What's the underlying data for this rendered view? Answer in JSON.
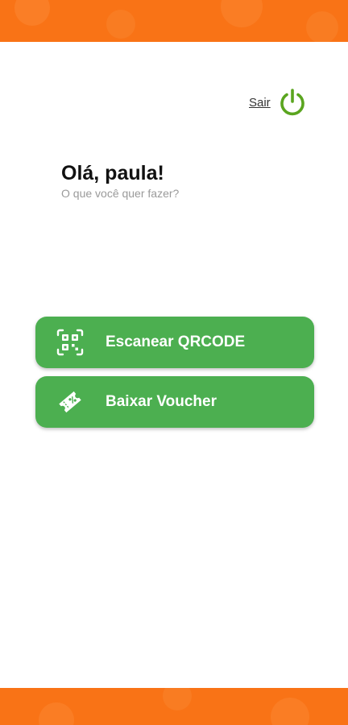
{
  "header": {
    "logout_label": "Sair",
    "logout_icon": "power-icon"
  },
  "greeting": {
    "title": "Olá, paula!",
    "subtitle": "O que você quer fazer?"
  },
  "actions": [
    {
      "label": "Escanear QRCODE",
      "icon": "qrcode-icon"
    },
    {
      "label": "Baixar Voucher",
      "icon": "ticket-icon"
    }
  ],
  "colors": {
    "brand_orange": "#f97316",
    "button_green": "#4caf50",
    "power_icon_green": "#5aa51f"
  }
}
